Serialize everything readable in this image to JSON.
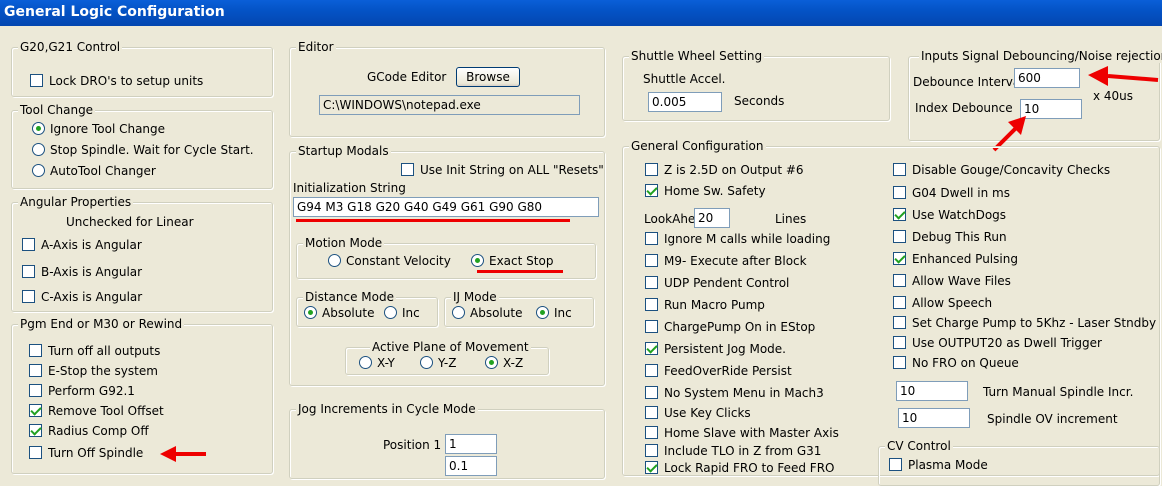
{
  "window": {
    "title": "General Logic Configuration"
  },
  "g20g21": {
    "legend": "G20,G21 Control",
    "lock_dro": "Lock DRO's to setup units"
  },
  "tool_change": {
    "legend": "Tool Change",
    "ignore": "Ignore Tool Change",
    "stop": "Stop Spindle. Wait for Cycle Start.",
    "auto": "AutoTool Changer"
  },
  "angular": {
    "legend": "Angular Properties",
    "note": "Unchecked for Linear",
    "a": "A-Axis is Angular",
    "b": "B-Axis is Angular",
    "c": "C-Axis is Angular"
  },
  "pgm_end": {
    "legend": "Pgm End or M30 or Rewind",
    "items": [
      "Turn off all outputs",
      "E-Stop the system",
      "Perform G92.1",
      "Remove Tool Offset",
      "Radius Comp Off",
      "Turn Off Spindle"
    ]
  },
  "editor": {
    "legend": "Editor",
    "label": "GCode Editor",
    "browse": "Browse",
    "path": "C:\\WINDOWS\\notepad.exe"
  },
  "startup": {
    "legend": "Startup Modals",
    "use_init": "Use Init String on ALL  \"Resets\"",
    "init_label": "Initialization String",
    "init_value": "G94 M3 G18 G20 G40 G49 G61 G90 G80",
    "motion_legend": "Motion Mode",
    "const_vel": "Constant Velocity",
    "exact_stop": "Exact Stop",
    "dist_legend": "Distance Mode",
    "ij_legend": "IJ Mode",
    "absolute": "Absolute",
    "inc": "Inc",
    "plane_legend": "Active Plane of Movement",
    "xy": "X-Y",
    "yz": "Y-Z",
    "xz": "X-Z"
  },
  "jog": {
    "legend": "Jog Increments in Cycle Mode",
    "pos1_label": "Position 1",
    "pos1": "1",
    "pos2": "0.1"
  },
  "shuttle": {
    "legend": "Shuttle Wheel Setting",
    "accel_label": "Shuttle Accel.",
    "accel": "0.005",
    "unit": "Seconds"
  },
  "debounce": {
    "legend": "Inputs Signal Debouncing/Noise rejection",
    "interval_label": "Debounce Interval:",
    "interval": "600",
    "unit": "x 40us",
    "index_label": "Index Debounce",
    "index": "10"
  },
  "general": {
    "legend": "General Configuration",
    "left": [
      "Z is 2.5D on Output #6",
      "Home Sw. Safety",
      "",
      "Ignore M calls while loading",
      "M9- Execute after Block",
      "UDP Pendent Control",
      "Run Macro Pump",
      "ChargePump On in EStop",
      "Persistent Jog Mode.",
      "FeedOverRide Persist",
      "No System Menu in Mach3",
      "Use Key Clicks",
      "Home Slave with Master Axis",
      "Include TLO in Z from G31",
      "Lock Rapid FRO to Feed FRO"
    ],
    "lookahead_label": "LookAhead",
    "lookahead": "20",
    "lines": "Lines",
    "right": [
      "Disable Gouge/Concavity Checks",
      "G04 Dwell in ms",
      "Use WatchDogs",
      "Debug This Run",
      "Enhanced Pulsing",
      "Allow Wave Files",
      "Allow Speech",
      "Set Charge Pump to 5Khz  - Laser Stndby",
      "Use OUTPUT20 as Dwell Trigger",
      "No FRO on Queue"
    ],
    "spindle_incr": "10",
    "spindle_incr_label": "Turn Manual Spindle Incr.",
    "spindle_ov": "10",
    "spindle_ov_label": "Spindle OV increment"
  },
  "cv": {
    "legend": "CV Control",
    "plasma": "Plasma Mode"
  },
  "colors": {
    "title_bar": "#0453c6",
    "annotation": "#ee0000",
    "check": "#21a121"
  }
}
